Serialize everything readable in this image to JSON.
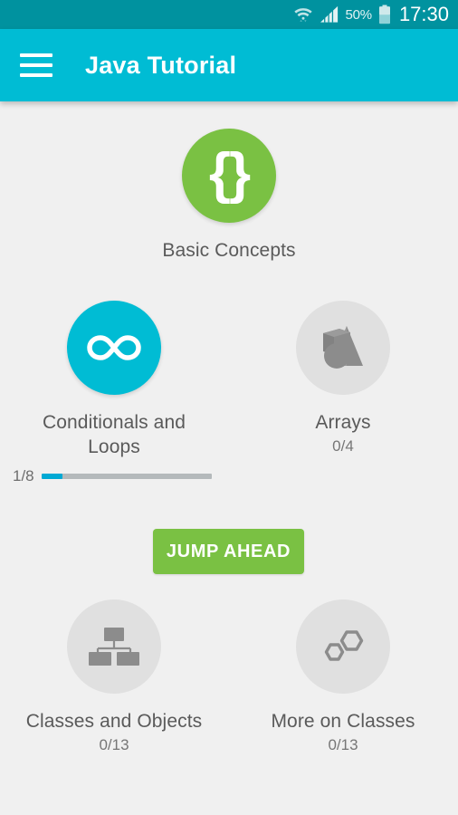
{
  "status_bar": {
    "wifi_icon": "wifi-icon",
    "signal_icon": "signal-bars-icon",
    "battery_percent": "50%",
    "battery_icon": "battery-icon",
    "clock": "17:30",
    "background_color": "#00929f"
  },
  "app_bar": {
    "menu_icon": "hamburger-menu-icon",
    "title": "Java Tutorial",
    "background_color": "#00bcd4"
  },
  "jump_ahead": {
    "label": "JUMP AHEAD",
    "color": "#7ac143"
  },
  "progress": {
    "label": "1/8",
    "completed": 1,
    "total": 8,
    "percent": 12.5,
    "fill_color": "#00a9d4",
    "track_color": "#b4b9bb"
  },
  "tiles": [
    {
      "id": "basic-concepts",
      "label": "Basic Concepts",
      "progress_text": "",
      "icon": "curly-braces-icon",
      "state": "completed",
      "circle_color": "#7ac143"
    },
    {
      "id": "conditionals-and-loops",
      "label": "Conditionals and Loops",
      "progress_text": "",
      "icon": "infinity-icon",
      "state": "active",
      "circle_color": "#00bcd4"
    },
    {
      "id": "arrays",
      "label": "Arrays",
      "progress_text": "0/4",
      "icon": "3d-shapes-icon",
      "state": "locked",
      "circle_color": "#e0e0e0"
    },
    {
      "id": "classes-and-objects",
      "label": "Classes and Objects",
      "progress_text": "0/13",
      "icon": "hierarchy-icon",
      "state": "locked",
      "circle_color": "#e0e0e0"
    },
    {
      "id": "more-on-classes",
      "label": "More on Classes",
      "progress_text": "0/13",
      "icon": "hexagons-icon",
      "state": "locked",
      "circle_color": "#e0e0e0"
    }
  ],
  "background_color": "#f0f0f0"
}
